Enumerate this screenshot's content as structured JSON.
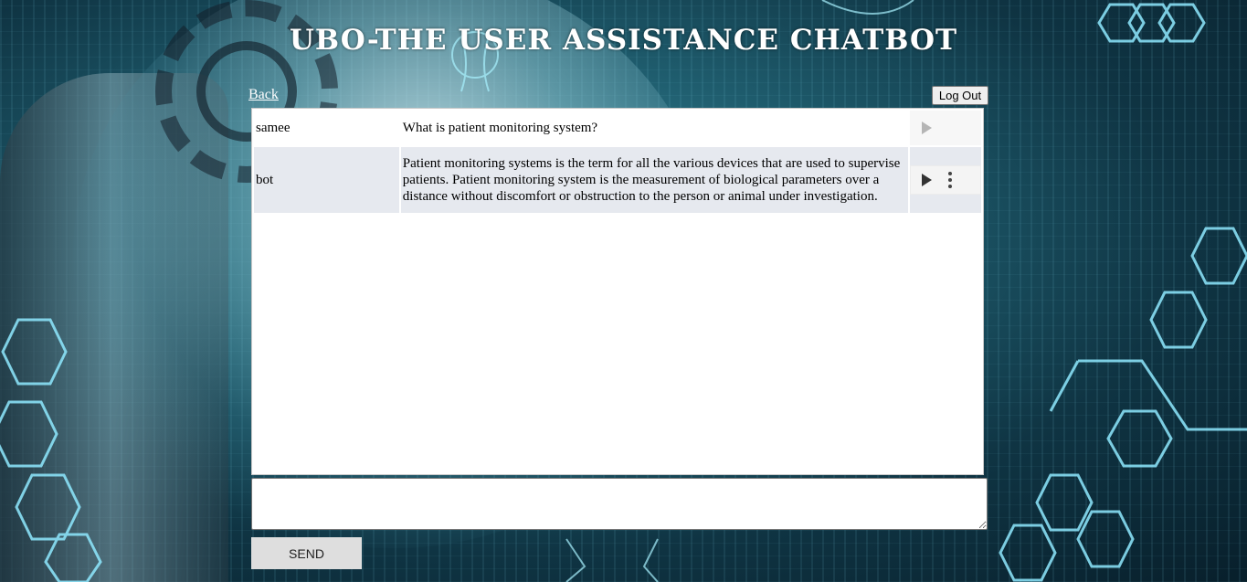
{
  "header": {
    "title": "UBO-THE USER ASSISTANCE CHATBOT"
  },
  "nav": {
    "back_label": "Back",
    "logout_label": "Log Out"
  },
  "chat": {
    "messages": [
      {
        "sender": "samee",
        "text": "What is patient monitoring system?",
        "audio_icons": [
          "play-icon"
        ]
      },
      {
        "sender": "bot",
        "text": "Patient monitoring systems is the term for all the various devices that are used to supervise patients. Patient monitoring system is the measurement of biological parameters over a distance without discomfort or obstruction to the person or animal under investigation.",
        "audio_icons": [
          "play-icon",
          "more-vertical-icon"
        ]
      }
    ]
  },
  "composer": {
    "input_value": "",
    "send_label": "SEND"
  }
}
